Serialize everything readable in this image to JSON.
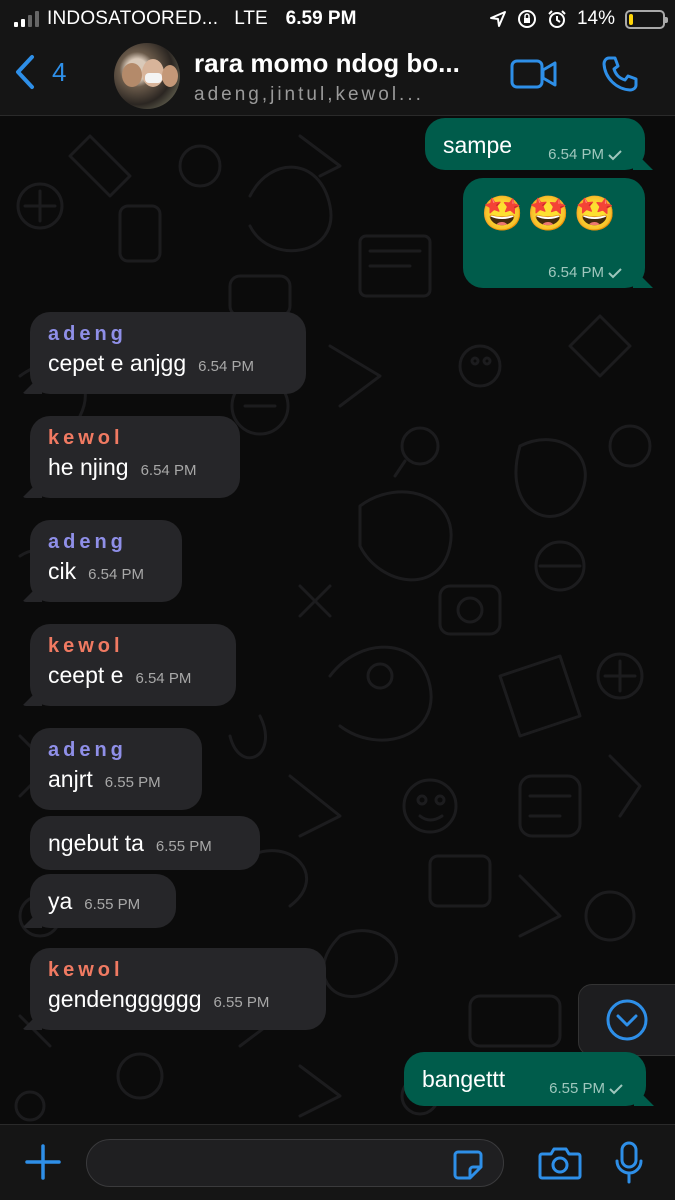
{
  "status_bar": {
    "carrier": "INDOSATOORED...",
    "network": "LTE",
    "time": "6.59 PM",
    "battery": "14%",
    "battery_level": 0.14
  },
  "header": {
    "back_count": "4",
    "title": "rara momo ndog bo...",
    "subtitle": "adeng,jintul,kewol..."
  },
  "messages": [
    {
      "dir": "out",
      "text": "sampe",
      "time": "6.54 PM"
    },
    {
      "dir": "out",
      "text": "🤩🤩🤩",
      "time": "6.54 PM"
    },
    {
      "dir": "in",
      "sender": "adeng",
      "text": "cepet e anjgg",
      "time": "6.54 PM"
    },
    {
      "dir": "in",
      "sender": "kewol",
      "text": "he njing",
      "time": "6.54 PM"
    },
    {
      "dir": "in",
      "sender": "adeng",
      "text": "cik",
      "time": "6.54 PM"
    },
    {
      "dir": "in",
      "sender": "kewol",
      "text": "ceept e",
      "time": "6.54 PM"
    },
    {
      "dir": "in",
      "sender": "adeng",
      "text": "anjrt",
      "time": "6.55 PM"
    },
    {
      "dir": "in",
      "text": "ngebut ta",
      "time": "6.55 PM"
    },
    {
      "dir": "in",
      "text": "ya",
      "time": "6.55 PM"
    },
    {
      "dir": "in",
      "sender": "kewol",
      "text": "gendengggggg",
      "time": "6.55 PM"
    },
    {
      "dir": "out",
      "text": "bangettt",
      "time": "6.55 PM"
    }
  ],
  "input": {
    "placeholder": "",
    "value": ""
  },
  "colors": {
    "accent": "#2e8fe8",
    "outgoing_bubble": "#005c4b",
    "incoming_bubble": "#262629",
    "sender_adeng": "#8f8fe8",
    "sender_kewol": "#f07a62"
  },
  "icons": {
    "back": "chevron-left-icon",
    "video": "video-camera-icon",
    "call": "phone-icon",
    "scroll": "chevron-down-circle-icon",
    "plus": "plus-icon",
    "sticker": "sticker-icon",
    "camera": "camera-icon",
    "mic": "microphone-icon"
  }
}
